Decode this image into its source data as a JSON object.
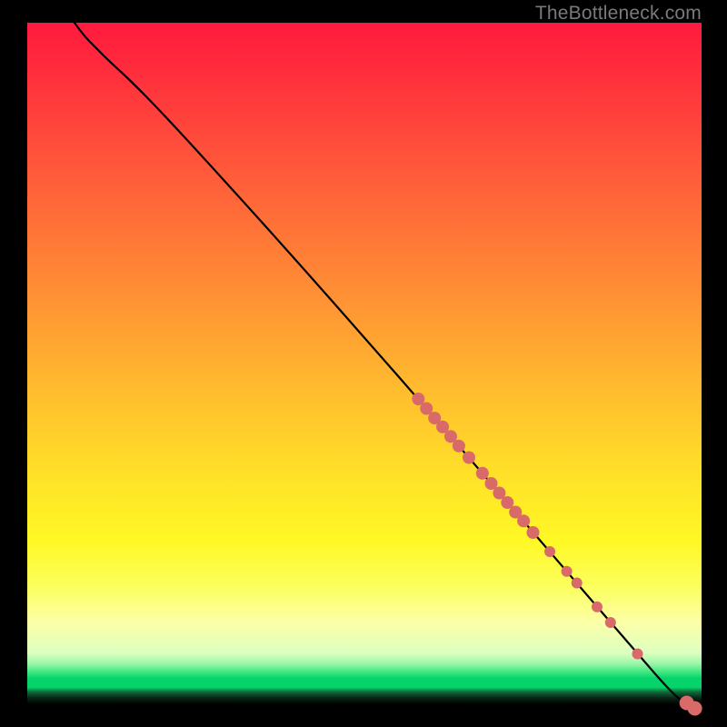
{
  "watermark": "TheBottleneck.com",
  "colors": {
    "dot": "#d86a6a",
    "curve": "#000000"
  },
  "chart_data": {
    "type": "line",
    "title": "",
    "xlabel": "",
    "ylabel": "",
    "xlim": [
      0,
      100
    ],
    "ylim": [
      0,
      100
    ],
    "curve": [
      {
        "x": 7.0,
        "y": 100.0
      },
      {
        "x": 8.5,
        "y": 98.0
      },
      {
        "x": 10.0,
        "y": 96.5
      },
      {
        "x": 12.0,
        "y": 94.5
      },
      {
        "x": 15.0,
        "y": 91.8
      },
      {
        "x": 20.0,
        "y": 86.8
      },
      {
        "x": 30.0,
        "y": 76.0
      },
      {
        "x": 40.0,
        "y": 65.0
      },
      {
        "x": 50.0,
        "y": 53.8
      },
      {
        "x": 60.0,
        "y": 42.5
      },
      {
        "x": 70.0,
        "y": 31.0
      },
      {
        "x": 80.0,
        "y": 19.5
      },
      {
        "x": 90.0,
        "y": 8.0
      },
      {
        "x": 96.0,
        "y": 1.2
      },
      {
        "x": 98.0,
        "y": 0.0
      }
    ],
    "dots": [
      {
        "x": 58.0,
        "y": 44.8,
        "r": 7
      },
      {
        "x": 59.2,
        "y": 43.4,
        "r": 7
      },
      {
        "x": 60.4,
        "y": 42.0,
        "r": 7
      },
      {
        "x": 61.6,
        "y": 40.7,
        "r": 7
      },
      {
        "x": 62.8,
        "y": 39.3,
        "r": 7
      },
      {
        "x": 64.0,
        "y": 37.9,
        "r": 7
      },
      {
        "x": 65.5,
        "y": 36.2,
        "r": 7
      },
      {
        "x": 67.5,
        "y": 33.9,
        "r": 7
      },
      {
        "x": 68.8,
        "y": 32.4,
        "r": 7
      },
      {
        "x": 70.0,
        "y": 31.0,
        "r": 7
      },
      {
        "x": 71.2,
        "y": 29.6,
        "r": 7
      },
      {
        "x": 72.4,
        "y": 28.2,
        "r": 7
      },
      {
        "x": 73.6,
        "y": 26.9,
        "r": 7
      },
      {
        "x": 75.0,
        "y": 25.2,
        "r": 7
      },
      {
        "x": 77.5,
        "y": 22.4,
        "r": 6
      },
      {
        "x": 80.0,
        "y": 19.5,
        "r": 6
      },
      {
        "x": 81.5,
        "y": 17.8,
        "r": 6
      },
      {
        "x": 84.5,
        "y": 14.3,
        "r": 6
      },
      {
        "x": 86.5,
        "y": 12.0,
        "r": 6
      },
      {
        "x": 90.5,
        "y": 7.4,
        "r": 6
      },
      {
        "x": 97.8,
        "y": 0.2,
        "r": 8
      },
      {
        "x": 99.0,
        "y": -0.6,
        "r": 8
      }
    ]
  }
}
